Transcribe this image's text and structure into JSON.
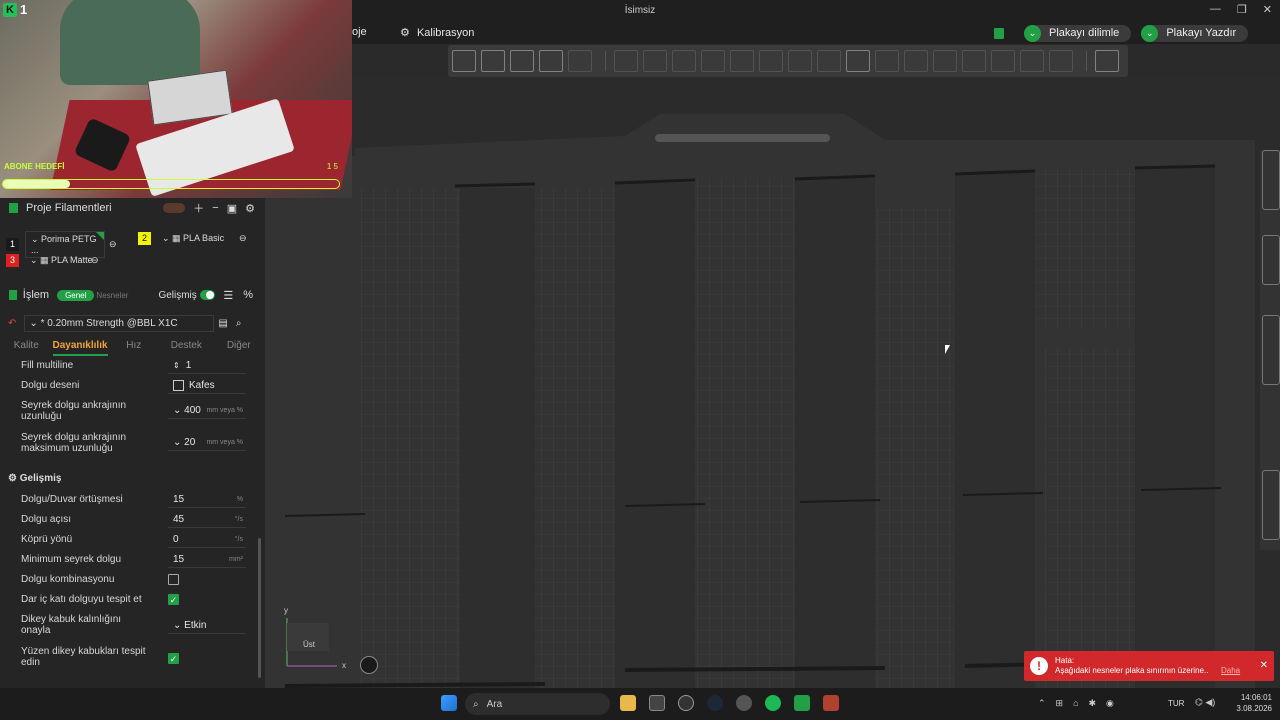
{
  "window": {
    "title": "İsimsiz",
    "minimize": "—",
    "maximize": "❐",
    "close": "✕"
  },
  "menu": {
    "project_fragment": "oje",
    "calibration": "Kalibrasyon"
  },
  "actions": {
    "slice": "Plakayı dilimle",
    "print": "Plakayı Yazdır"
  },
  "webcam": {
    "logo": "K",
    "count": "1",
    "goal_label": "ABONE HEDEFİ",
    "goal_count": "1 5",
    "goal_progress": 0.2
  },
  "filaments": {
    "title": "Proje Filamentleri",
    "items": [
      {
        "index": "1",
        "name": "Porima PETG ...",
        "color": "#1a1a1a"
      },
      {
        "index": "2",
        "name": "PLA Basic",
        "color": "#f4f400"
      },
      {
        "index": "3",
        "name": "PLA Matte",
        "color": "#e02020"
      }
    ]
  },
  "process": {
    "title": "İşlem",
    "toggle_global": "Genel",
    "toggle_objects": "Nesneler",
    "advanced_label": "Gelişmiş",
    "profile": "* 0.20mm Strength @BBL X1C"
  },
  "tabs": [
    "Kalite",
    "Dayanıklılık",
    "Hız",
    "Destek",
    "Diğer"
  ],
  "settings": {
    "fill_multiline_label": "Fill multiline",
    "fill_multiline_value": "1",
    "pattern_label": "Dolgu deseni",
    "pattern_value": "Kafes",
    "anchor_label_1": "Seyrek dolgu ankrajının",
    "anchor_label_2": "uzunluğu",
    "anchor_value": "400",
    "anchor_unit": "mm veya %",
    "anchor_max_label_1": "Seyrek dolgu ankrajının",
    "anchor_max_label_2": "maksimum uzunluğu",
    "anchor_max_value": "20",
    "anchor_max_unit": "mm veya %",
    "advanced_section": "Gelişmiş",
    "overlap_label": "Dolgu/Duvar örtüşmesi",
    "overlap_value": "15",
    "overlap_unit": "%",
    "angle_label": "Dolgu açısı",
    "angle_value": "45",
    "angle_unit": "°/s",
    "bridge_label": "Köprü yönü",
    "bridge_value": "0",
    "bridge_unit": "°/s",
    "min_sparse_label": "Minimum seyrek dolgu",
    "min_sparse_value": "15",
    "min_sparse_unit": "mm²",
    "combination_label": "Dolgu kombinasyonu",
    "narrow_label": "Dar iç katı dolguyu tespit et",
    "vshell_label_1": "Dikey kabuk kalınlığını",
    "vshell_label_2": "onayla",
    "vshell_value": "Etkin",
    "floating_label_1": "Yüzen dikey kabukları tespit",
    "floating_label_2": "edin"
  },
  "viewport": {
    "axis_y": "y",
    "axis_x": "x",
    "view_label": "Üst"
  },
  "error": {
    "title": "Hata:",
    "message": "Aşağıdaki nesneler plaka sınırının üzerine..",
    "more": "Daha"
  },
  "taskbar": {
    "search": "Ara",
    "lang": "TUR",
    "time": "14:06:01",
    "date": "3.08.2026"
  }
}
